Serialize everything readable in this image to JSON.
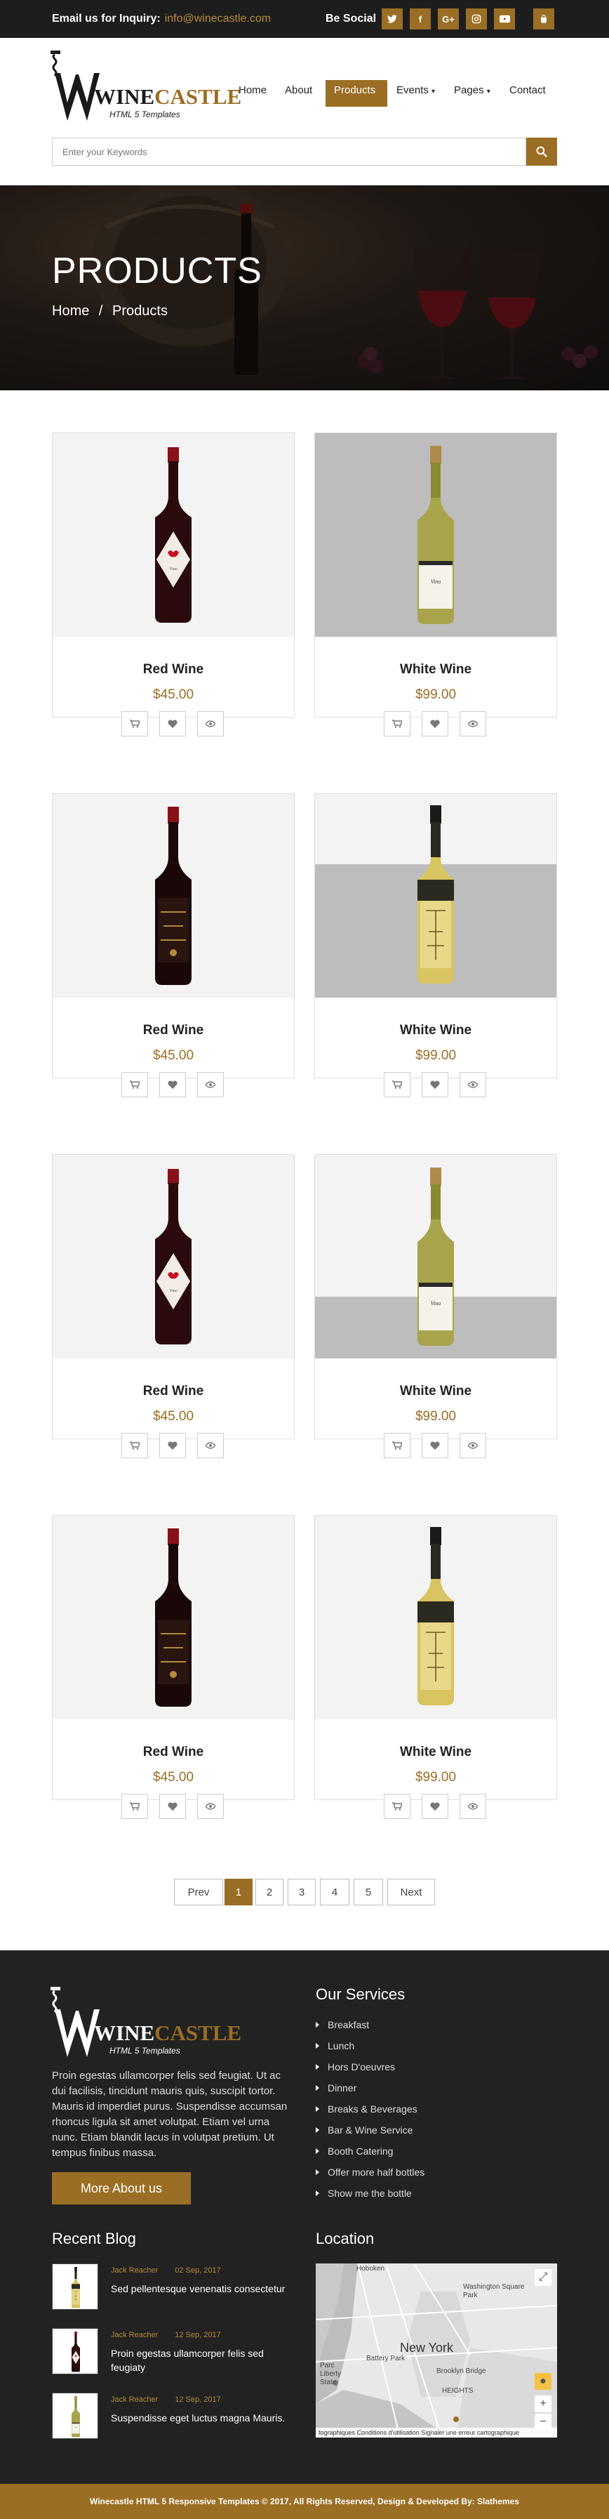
{
  "topbar": {
    "inquiry_label": "Email us for Inquiry:",
    "inquiry_email": "info@winecastle.com",
    "social_label": "Be Social",
    "social_icons": [
      "twitter-icon",
      "facebook-icon",
      "google-plus-icon",
      "instagram-icon",
      "youtube-icon"
    ],
    "cart_icon": "shopping-bag-icon"
  },
  "brand": {
    "name_prefix": "WINE",
    "name_suffix": "CASTLE",
    "tagline": "HTML 5 Templates",
    "accent_color": "#9a6e24"
  },
  "nav": {
    "items": [
      {
        "label": "Home"
      },
      {
        "label": "About"
      },
      {
        "label": "Products",
        "active": true
      },
      {
        "label": "Events"
      },
      {
        "label": "Pages"
      },
      {
        "label": "Contact"
      }
    ],
    "dropdown_marker": "▾"
  },
  "search": {
    "placeholder": "Enter your Keywords",
    "icon": "search-icon"
  },
  "hero": {
    "title": "PRODUCTS",
    "breadcrumb": [
      "Home",
      "/",
      "Products"
    ]
  },
  "products": [
    {
      "name": "Red Wine",
      "price": "$45.00",
      "bottle": "red-label"
    },
    {
      "name": "White Wine",
      "price": "$99.00",
      "bottle": "white-label"
    },
    {
      "name": "Red Wine",
      "price": "$45.00",
      "bottle": "red-dark"
    },
    {
      "name": "White Wine",
      "price": "$99.00",
      "bottle": "white-gold"
    },
    {
      "name": "Red Wine",
      "price": "$45.00",
      "bottle": "red-label"
    },
    {
      "name": "White Wine",
      "price": "$99.00",
      "bottle": "white-label"
    },
    {
      "name": "Red Wine",
      "price": "$45.00",
      "bottle": "red-dark"
    },
    {
      "name": "White Wine",
      "price": "$99.00",
      "bottle": "white-gold"
    }
  ],
  "product_actions": [
    "cart-icon",
    "heart-icon",
    "eye-icon"
  ],
  "pagination": {
    "prev": "Prev",
    "pages": [
      "1",
      "2",
      "3",
      "4",
      "5"
    ],
    "current": "1",
    "next": "Next"
  },
  "footer": {
    "about_text": "Proin egestas ullamcorper felis sed feugiat. Ut ac dui facilisis, tincidunt mauris quis, suscipit tortor. Mauris id imperdiet purus. Suspendisse accumsan rhoncus ligula sit amet volutpat. Etiam vel urna nunc. Etiam blandit lacus in volutpat pretium. Ut tempus finibus massa.",
    "more_button": "More About us",
    "services_title": "Our Services",
    "services": [
      "Breakfast",
      "Lunch",
      "Hors D'oeuvres",
      "Dinner",
      "Breaks & Beverages",
      "Bar & Wine Service",
      "Booth Catering",
      "Offer more half bottles",
      "Show me the bottle"
    ],
    "blog_title": "Recent Blog",
    "blog_posts": [
      {
        "author": "Jack Reacher",
        "date": "02 Sep, 2017",
        "title": "Sed pellentesque venenatis consectetur"
      },
      {
        "author": "Jack Reacher",
        "date": "12 Sep, 2017",
        "title": "Proin egestas ullamcorper felis sed feugiaty"
      },
      {
        "author": "Jack Reacher",
        "date": "12 Sep, 2017",
        "title": "Suspendisse eget luctus magna Mauris."
      }
    ],
    "location_title": "Location",
    "map_labels": {
      "hoboken": "Hoboken",
      "washington": "Washington Square Park",
      "new_york": "New York",
      "battery": "Battery Park",
      "brooklyn_bridge": "Brooklyn Bridge",
      "park": "Parc",
      "liberty": "Liberty",
      "state": "State",
      "heights": "HEIGHTS",
      "zoom_in": "+",
      "zoom_out": "−",
      "attribution": "tographiques     Conditions d'utilisation     Signaler une erreur cartographique"
    }
  },
  "copyright": "Winecastle HTML 5 Responsive Templates © 2017, All Rights Reserved, Design & Developed By: Slathemes"
}
